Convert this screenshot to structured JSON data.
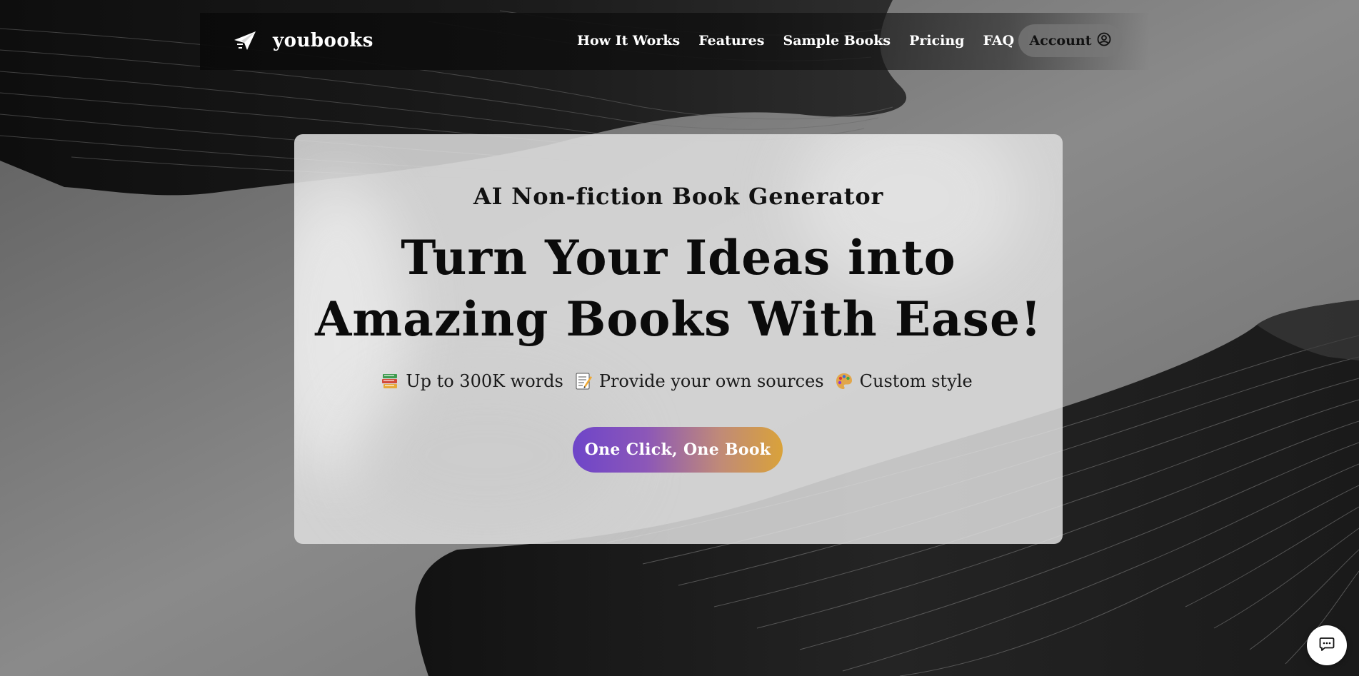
{
  "brand": {
    "name": "youbooks",
    "icon": "paper-plane-icon"
  },
  "nav": {
    "items": [
      {
        "label": "How It Works"
      },
      {
        "label": "Features"
      },
      {
        "label": "Sample Books"
      },
      {
        "label": "Pricing"
      },
      {
        "label": "FAQ"
      }
    ],
    "account_label": "Account",
    "account_icon": "user-circle-icon"
  },
  "hero": {
    "eyebrow": "AI Non-fiction Book Generator",
    "headline_line1": "Turn Your Ideas into",
    "headline_line2": "Amazing Books With Ease!",
    "features": [
      {
        "icon": "books-emoji",
        "text": "Up to 300K words"
      },
      {
        "icon": "memo-emoji",
        "text": "Provide your own sources"
      },
      {
        "icon": "palette-emoji",
        "text": "Custom style"
      }
    ],
    "cta_label": "One Click, One Book"
  },
  "chat": {
    "icon": "chat-bubble-icon"
  },
  "colors": {
    "cta_gradient_start": "#6e45c9",
    "cta_gradient_end": "#d9a23a",
    "background": "#7f7f7f",
    "card": "#dedede"
  }
}
